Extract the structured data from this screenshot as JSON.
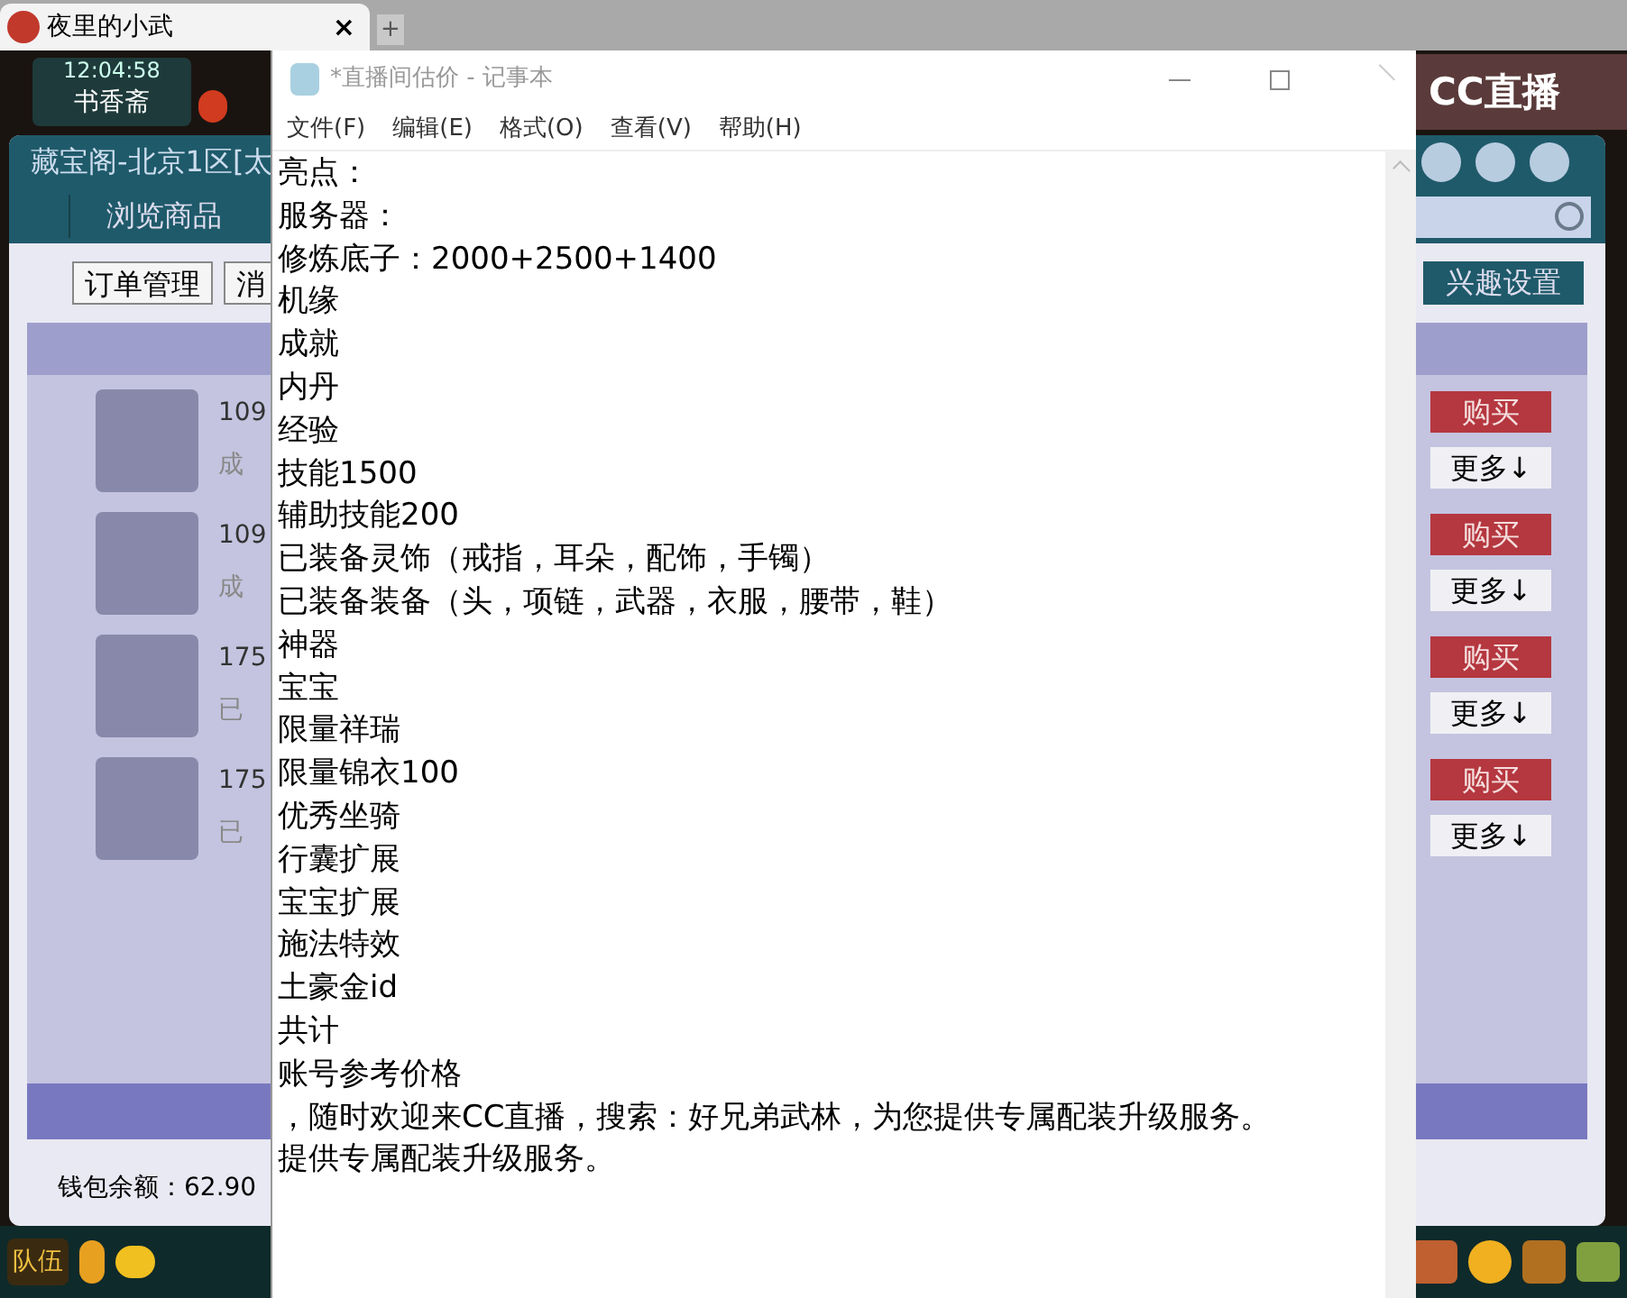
{
  "browser_tab": {
    "title": "夜里的小武",
    "close": "×",
    "new_tab": "+"
  },
  "game": {
    "clock": "12:04:58",
    "location": "书香斋",
    "stream_logo": "CC直播",
    "panel": {
      "title": "藏宝阁-北京1区[太",
      "nav_tab": "浏览商品",
      "toolbar": [
        "订单管理",
        "消"
      ],
      "interest_button": "兴趣设置",
      "listings": [
        {
          "line_1": "109",
          "line_2": "成",
          "buy": "购买",
          "more": "更多↓"
        },
        {
          "line_1": "109",
          "line_2": "成",
          "buy": "购买",
          "more": "更多↓"
        },
        {
          "line_1": "175",
          "line_2": "已",
          "buy": "购买",
          "more": "更多↓"
        },
        {
          "line_1": "175",
          "line_2": "已",
          "buy": "购买",
          "more": "更多↓"
        }
      ],
      "wallet": "钱包余额：62.90"
    },
    "bottom_bar": {
      "team_button": "队伍"
    }
  },
  "notepad": {
    "title": "*直播间估价 - 记事本",
    "menu": [
      "文件(F)",
      "编辑(E)",
      "格式(O)",
      "查看(V)",
      "帮助(H)"
    ],
    "lines": [
      "亮点：",
      "服务器：",
      "修炼底子：2000+2500+1400",
      "机缘",
      "成就",
      "内丹",
      "经验",
      "技能1500",
      "辅助技能200",
      "已装备灵饰（戒指，耳朵，配饰，手镯）",
      "已装备装备（头，项链，武器，衣服，腰带，鞋）",
      "神器",
      "宝宝",
      "限量祥瑞",
      "限量锦衣100",
      "优秀坐骑",
      "行囊扩展",
      "宝宝扩展",
      "施法特效",
      "土豪金id",
      "共计",
      "账号参考价格",
      "，随时欢迎来CC直播，搜索：好兄弟武林，为您提供专属配装升级服务。",
      "提供专属配装升级服务。"
    ]
  }
}
